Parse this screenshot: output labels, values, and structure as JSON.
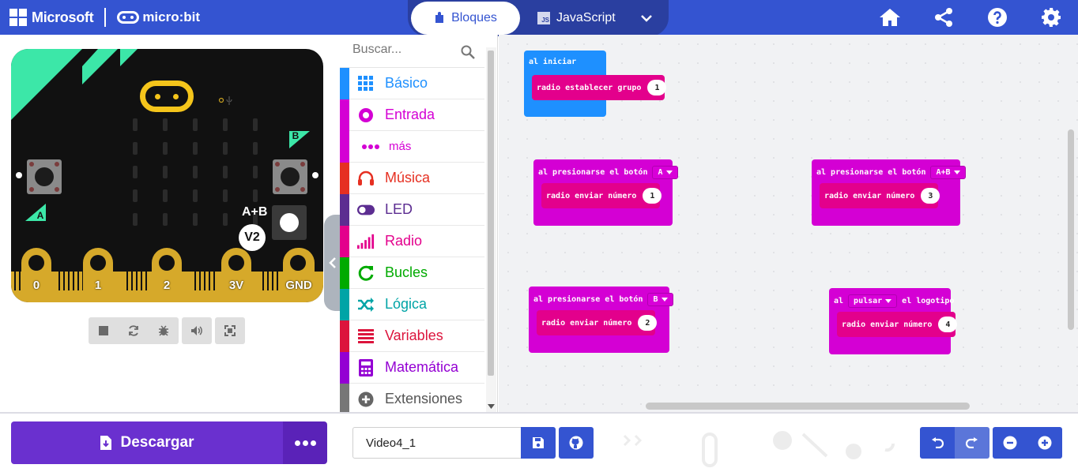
{
  "header": {
    "brand_microsoft": "Microsoft",
    "brand_microbit": "micro:bit",
    "tab_blocks": "Bloques",
    "tab_javascript": "JavaScript",
    "js_badge": "JS",
    "icons": [
      "home-icon",
      "share-icon",
      "help-icon",
      "settings-icon"
    ]
  },
  "simulator": {
    "button_a": "A",
    "button_b": "B",
    "button_ab": "A+B",
    "version_badge": "V2",
    "pins": [
      "0",
      "1",
      "2",
      "3V",
      "GND"
    ],
    "controls": [
      "stop-icon",
      "restart-icon",
      "debug-icon",
      "mute-icon",
      "fullscreen-icon"
    ]
  },
  "toolbox": {
    "search_placeholder": "Buscar...",
    "categories": [
      {
        "label": "Básico",
        "color": "#1e90ff",
        "icon": "grid-icon"
      },
      {
        "label": "Entrada",
        "color": "#d400d4",
        "icon": "input-icon"
      },
      {
        "label": "más",
        "color": "#d400d4",
        "icon": "more-dots-icon"
      },
      {
        "label": "Música",
        "color": "#e63022",
        "icon": "headphones-icon"
      },
      {
        "label": "LED",
        "color": "#5c2d91",
        "icon": "toggle-icon"
      },
      {
        "label": "Radio",
        "color": "#e3008c",
        "icon": "signal-icon"
      },
      {
        "label": "Bucles",
        "color": "#00aa00",
        "icon": "loop-icon"
      },
      {
        "label": "Lógica",
        "color": "#00a4a6",
        "icon": "shuffle-icon"
      },
      {
        "label": "Variables",
        "color": "#dc143c",
        "icon": "lines-icon"
      },
      {
        "label": "Matemática",
        "color": "#9400d3",
        "icon": "calculator-icon"
      },
      {
        "label": "Extensiones",
        "color": "#777777",
        "icon": "plus-circle-icon"
      }
    ]
  },
  "workspace": {
    "on_start": {
      "title": "al iniciar",
      "stmt": "radio establecer grupo",
      "value": "1"
    },
    "btn_a": {
      "prefix": "al presionarse el botón",
      "button": "A",
      "stmt": "radio enviar número",
      "value": "1"
    },
    "btn_ab": {
      "prefix": "al presionarse el botón",
      "button": "A+B",
      "stmt": "radio enviar número",
      "value": "3"
    },
    "btn_b": {
      "prefix": "al presionarse el botón",
      "button": "B",
      "stmt": "radio enviar número",
      "value": "2"
    },
    "logo": {
      "prefix": "al",
      "event": "pulsar",
      "suffix": "el logotipo",
      "stmt": "radio enviar número",
      "value": "4"
    }
  },
  "footer": {
    "download_label": "Descargar",
    "project_name": "Video4_1"
  },
  "colors": {
    "header": "#3454d1",
    "basic_block": "#1e90ff",
    "input_block": "#d400d4",
    "radio_block": "#e3008c",
    "download": "#6a30cf"
  }
}
